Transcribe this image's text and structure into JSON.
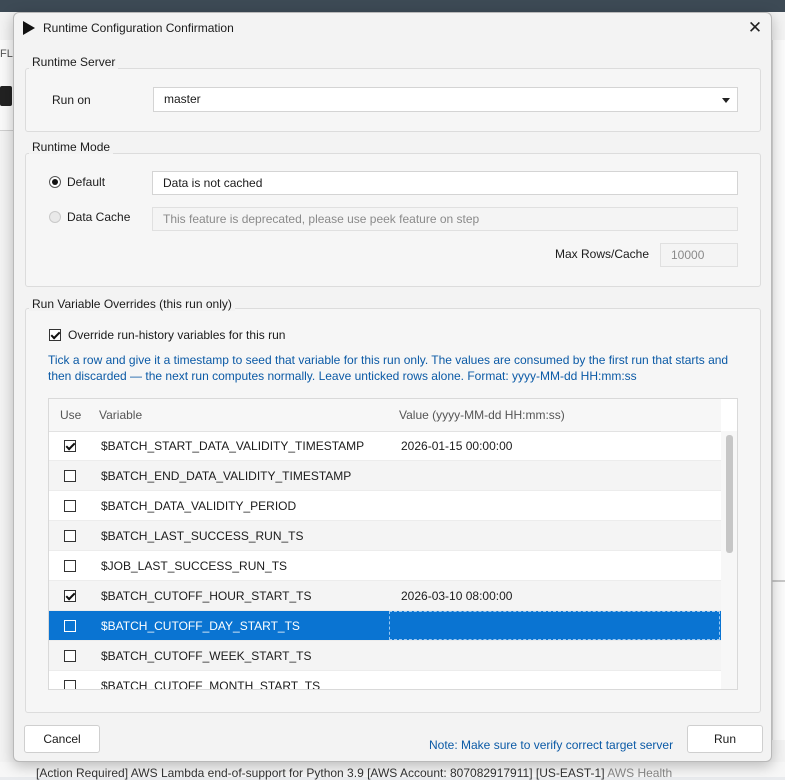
{
  "background": {
    "left_fragment_text": "FL",
    "status_text": "[Action Required] AWS Lambda end-of-support for Python 3.9 [AWS Account: 807082917911] [US-EAST-1]",
    "status_text_muted": "AWS Health"
  },
  "dialog": {
    "title": "Runtime Configuration Confirmation",
    "close_label": "✕"
  },
  "runtime_server": {
    "group_label": "Runtime Server",
    "run_on_label": "Run on",
    "run_on_value": "master"
  },
  "runtime_mode": {
    "group_label": "Runtime Mode",
    "default_label": "Default",
    "default_value": "Data is not cached",
    "default_selected": true,
    "data_cache_label": "Data Cache",
    "data_cache_placeholder": "This feature is deprecated, please use peek feature on step",
    "max_rows_label": "Max Rows/Cache",
    "max_rows_value": "10000"
  },
  "overrides": {
    "group_label": "Run Variable Overrides (this run only)",
    "override_checkbox_label": "Override run-history variables for this run",
    "override_checked": true,
    "hint_line1": "Tick a row and give it a timestamp to seed that variable for this run only. The values are consumed by the first run that starts and",
    "hint_line2": "then discarded — the next run computes normally. Leave unticked rows alone. Format: yyyy-MM-dd HH:mm:ss",
    "columns": {
      "use": "Use",
      "variable": "Variable",
      "value": "Value (yyyy-MM-dd HH:mm:ss)"
    },
    "rows": [
      {
        "use": true,
        "variable": "$BATCH_START_DATA_VALIDITY_TIMESTAMP",
        "value": "2026-01-15 00:00:00"
      },
      {
        "use": false,
        "variable": "$BATCH_END_DATA_VALIDITY_TIMESTAMP",
        "value": ""
      },
      {
        "use": false,
        "variable": "$BATCH_DATA_VALIDITY_PERIOD",
        "value": ""
      },
      {
        "use": false,
        "variable": "$BATCH_LAST_SUCCESS_RUN_TS",
        "value": ""
      },
      {
        "use": false,
        "variable": "$JOB_LAST_SUCCESS_RUN_TS",
        "value": ""
      },
      {
        "use": true,
        "variable": "$BATCH_CUTOFF_HOUR_START_TS",
        "value": "2026-03-10 08:00:00"
      },
      {
        "use": false,
        "variable": "$BATCH_CUTOFF_DAY_START_TS",
        "value": "",
        "selected": true
      },
      {
        "use": false,
        "variable": "$BATCH_CUTOFF_WEEK_START_TS",
        "value": ""
      },
      {
        "use": false,
        "variable": "$BATCH_CUTOFF_MONTH_START_TS",
        "value": ""
      }
    ]
  },
  "footer": {
    "cancel_label": "Cancel",
    "note": "Note: Make sure to verify correct target server",
    "run_label": "Run"
  },
  "colors": {
    "accent": "#0a74d2",
    "hint_text": "#0b5aa6"
  }
}
